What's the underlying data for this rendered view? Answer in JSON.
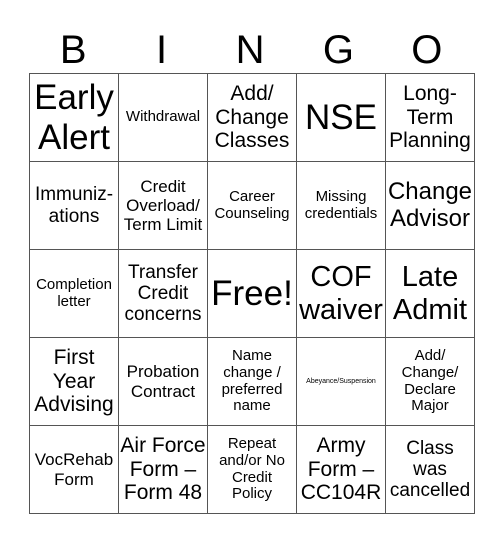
{
  "header": {
    "letters": [
      "B",
      "I",
      "N",
      "G",
      "O"
    ]
  },
  "cells": [
    [
      "Early\nAlert",
      "Withdrawal",
      "Add/\nChange\nClasses",
      "NSE",
      "Long-\nTerm\nPlanning"
    ],
    [
      "Immuniz-\nations",
      "Credit\nOverload/\nTerm Limit",
      "Career\nCounseling",
      "Missing\ncredentials",
      "Change\nAdvisor"
    ],
    [
      "Completion\nletter",
      "Transfer\nCredit\nconcerns",
      "Free!",
      "COF\nwaiver",
      "Late\nAdmit"
    ],
    [
      "First\nYear\nAdvising",
      "Probation\nContract",
      "Name\nchange /\npreferred\nname",
      "Abeyance/Suspension",
      "Add/\nChange/\nDeclare\nMajor"
    ],
    [
      "VocRehab\nForm",
      "Air Force\nForm –\nForm 48",
      "Repeat\nand/or No\nCredit\nPolicy",
      "Army\nForm –\nCC104R",
      "Class\nwas\ncancelled"
    ]
  ]
}
